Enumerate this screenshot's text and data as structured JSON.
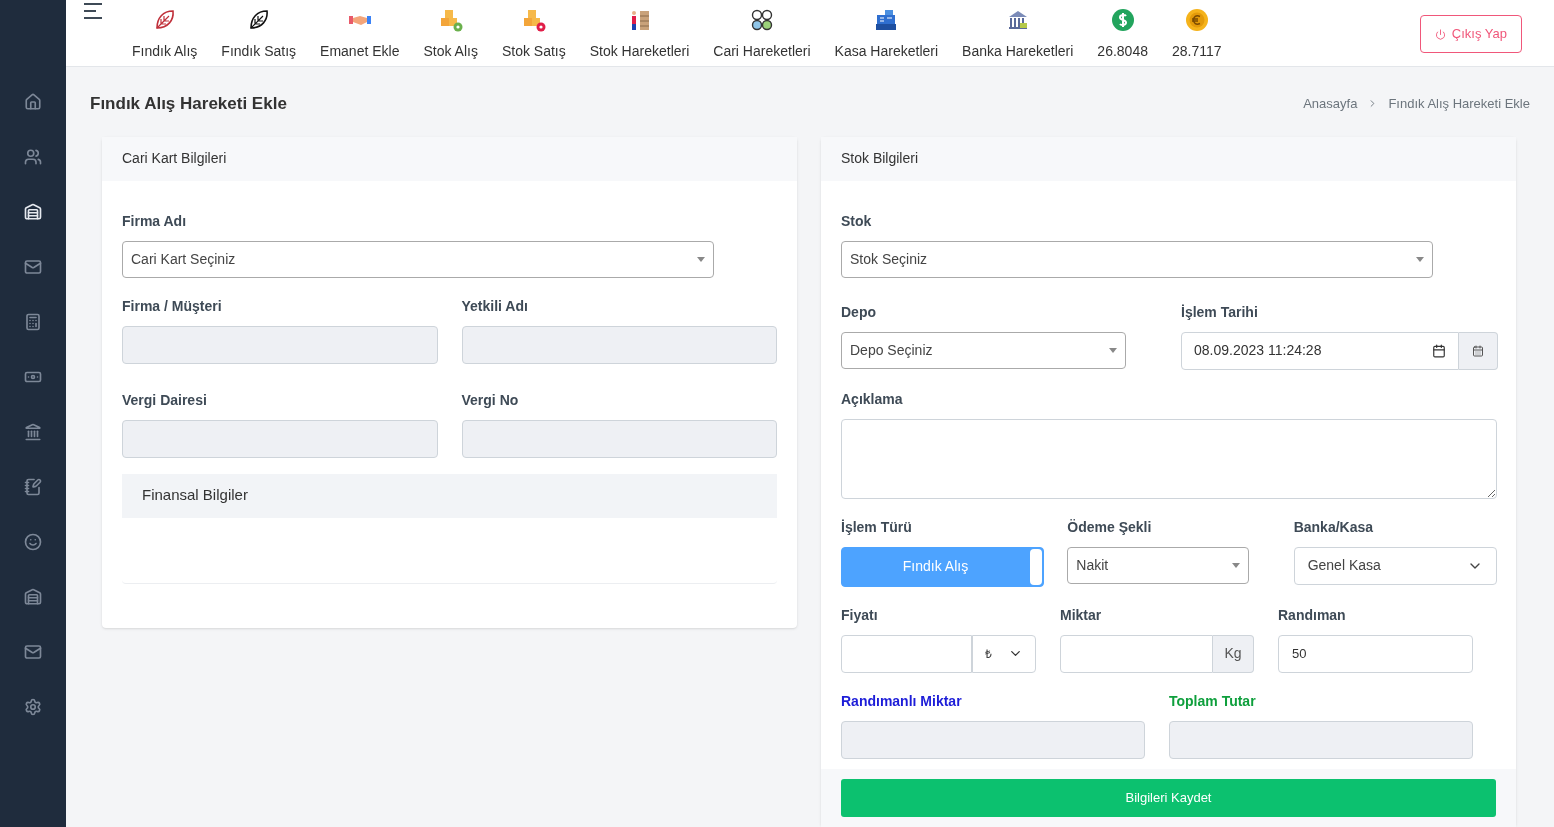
{
  "sidebar": {
    "items": [
      {
        "selected": false
      },
      {
        "selected": false
      },
      {
        "selected": true
      },
      {
        "selected": false
      },
      {
        "selected": false
      },
      {
        "selected": false
      },
      {
        "selected": false
      },
      {
        "selected": false
      },
      {
        "selected": false
      },
      {
        "selected": false
      },
      {
        "selected": false
      },
      {
        "selected": false
      }
    ]
  },
  "topbar": {
    "nav": [
      "Fındık Alış",
      "Fındık Satış",
      "Emanet Ekle",
      "Stok Alış",
      "Stok Satış",
      "Stok Hareketleri",
      "Cari Hareketleri",
      "Kasa Hareketleri",
      "Banka Hareketleri",
      "26.8048",
      "28.7117"
    ],
    "logout": "Çıkış Yap"
  },
  "page": {
    "title": "Fındık Alış Hareketi Ekle",
    "breadcrumb": [
      "Anasayfa",
      "Fındık Alış Hareketi Ekle"
    ]
  },
  "cari_card": {
    "title": "Cari Kart Bilgileri",
    "firma_label": "Firma Adı",
    "firma_select": "Cari Kart Seçiniz",
    "fields": [
      {
        "label": "Firma / Müşteri"
      },
      {
        "label": "Yetkili Adı"
      },
      {
        "label": "Vergi Dairesi"
      },
      {
        "label": "Vergi No"
      }
    ],
    "finance_title": "Finansal Bilgiler"
  },
  "stok_card": {
    "title": "Stok Bilgileri",
    "stok_label": "Stok",
    "stok_select": "Stok Seçiniz",
    "depo_label": "Depo",
    "depo_select": "Depo Seçiniz",
    "date_label": "İşlem Tarihi",
    "date_value": "08.09.2023 11:24:28",
    "aciklama_label": "Açıklama",
    "islem_label": "İşlem Türü",
    "islem_toggle": {
      "label": "Fındık Alış",
      "on": true
    },
    "odeme_label": "Ödeme Şekli",
    "odeme_value": "Nakit",
    "banka_label": "Banka/Kasa",
    "banka_value": "Genel Kasa",
    "fiyat_label": "Fiyatı",
    "currency": "₺",
    "miktar_label": "Miktar",
    "unit": "Kg",
    "randiman_label": "Randıman",
    "randiman_value": "50",
    "randimanli_label": "Randımanlı Miktar",
    "toplam_label": "Toplam Tutar",
    "save": "Bilgileri Kaydet"
  }
}
